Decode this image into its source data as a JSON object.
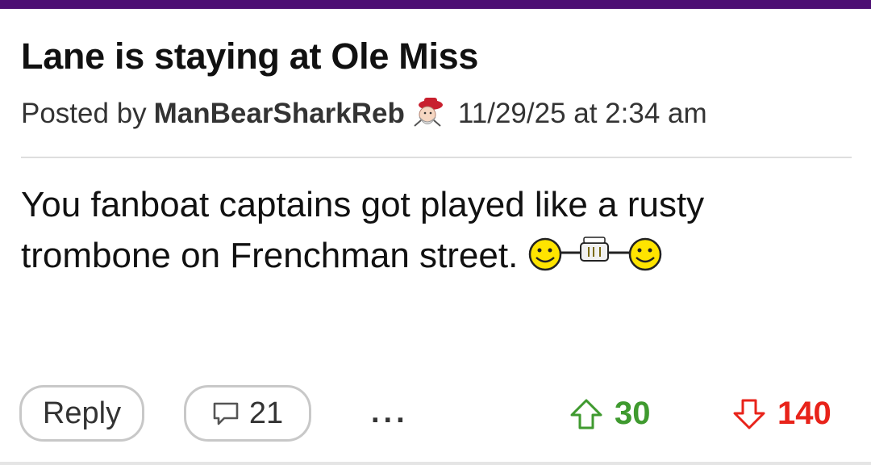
{
  "post": {
    "title": "Lane is staying at Ole Miss",
    "posted_by_label": "Posted by",
    "author": "ManBearSharkReb",
    "timestamp": "11/29/25 at 2:34 am",
    "body": "You fanboat captains got played like a rusty trombone on Frenchman street."
  },
  "actions": {
    "reply_label": "Reply",
    "comment_count": "21",
    "more_label": "...",
    "upvotes": "30",
    "downvotes": "140"
  },
  "icons": {
    "avatar": "colonel-reb-avatar-icon",
    "emote": "smiley-binoculars-smiley-emote",
    "comment": "speech-bubble-icon",
    "upvote": "arrow-up-icon",
    "downvote": "arrow-down-icon"
  },
  "colors": {
    "top_bar": "#4d0f73",
    "upvote": "#3f9a2f",
    "downvote": "#e8231a"
  }
}
